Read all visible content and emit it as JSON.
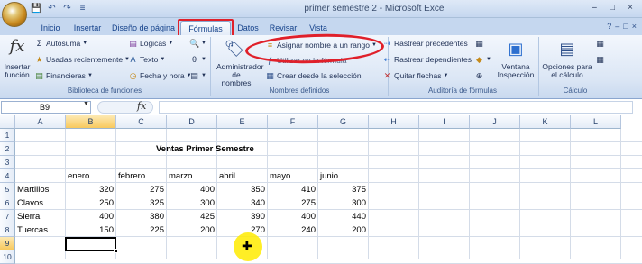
{
  "window": {
    "title": "primer semestre 2 - Microsoft Excel",
    "min_symbol": "–",
    "max_symbol": "□",
    "close_symbol": "×"
  },
  "qat": [
    "💾",
    "↶",
    "↷",
    "≡"
  ],
  "tabs": [
    {
      "label": "Inicio"
    },
    {
      "label": "Insertar"
    },
    {
      "label": "Diseño de página"
    },
    {
      "label": "Fórmulas"
    },
    {
      "label": "Datos"
    },
    {
      "label": "Revisar"
    },
    {
      "label": "Vista"
    }
  ],
  "ribbon": {
    "biblioteca": {
      "insert_function": "Insertar función",
      "autosuma": "Autosuma",
      "usadas": "Usadas recientemente",
      "financieras": "Financieras",
      "logicas": "Lógicas",
      "texto": "Texto",
      "fecha": "Fecha y hora",
      "label": "Biblioteca de funciones"
    },
    "nombres": {
      "admin": "Administrador de nombres",
      "asignar": "Asignar nombre a un rango",
      "utilizar": "Utilizar en la fórmula",
      "crear": "Crear desde la selección",
      "label": "Nombres definidos"
    },
    "auditoria": {
      "precedentes": "Rastrear precedentes",
      "dependientes": "Rastrear dependientes",
      "quitar": "Quitar flechas",
      "ventana": "Ventana Inspección",
      "label": "Auditoría de fórmulas"
    },
    "calculo": {
      "opciones": "Opciones para el cálculo",
      "label": "Cálculo"
    }
  },
  "formula_bar": {
    "name_box": "B9",
    "fx": "fx",
    "content": ""
  },
  "columns": [
    "A",
    "B",
    "C",
    "D",
    "E",
    "F",
    "G",
    "H",
    "I",
    "J",
    "K",
    "L"
  ],
  "rows": [
    "1",
    "2",
    "3",
    "4",
    "5",
    "6",
    "7",
    "8",
    "9",
    "10"
  ],
  "sheet": {
    "title": "Ventas Primer Semestre",
    "months": [
      "enero",
      "febrero",
      "marzo",
      "abril",
      "mayo",
      "junio"
    ],
    "data": [
      {
        "name": "Martillos",
        "values": [
          "320",
          "275",
          "400",
          "350",
          "410",
          "375"
        ]
      },
      {
        "name": "Clavos",
        "values": [
          "250",
          "325",
          "300",
          "340",
          "275",
          "300"
        ]
      },
      {
        "name": "Sierra",
        "values": [
          "400",
          "380",
          "425",
          "390",
          "400",
          "440"
        ]
      },
      {
        "name": "Tuercas",
        "values": [
          "150",
          "225",
          "200",
          "270",
          "240",
          "200"
        ]
      }
    ]
  },
  "colors": {
    "annotation": "#e0202a",
    "cursor_highlight": "#ffeb00"
  }
}
